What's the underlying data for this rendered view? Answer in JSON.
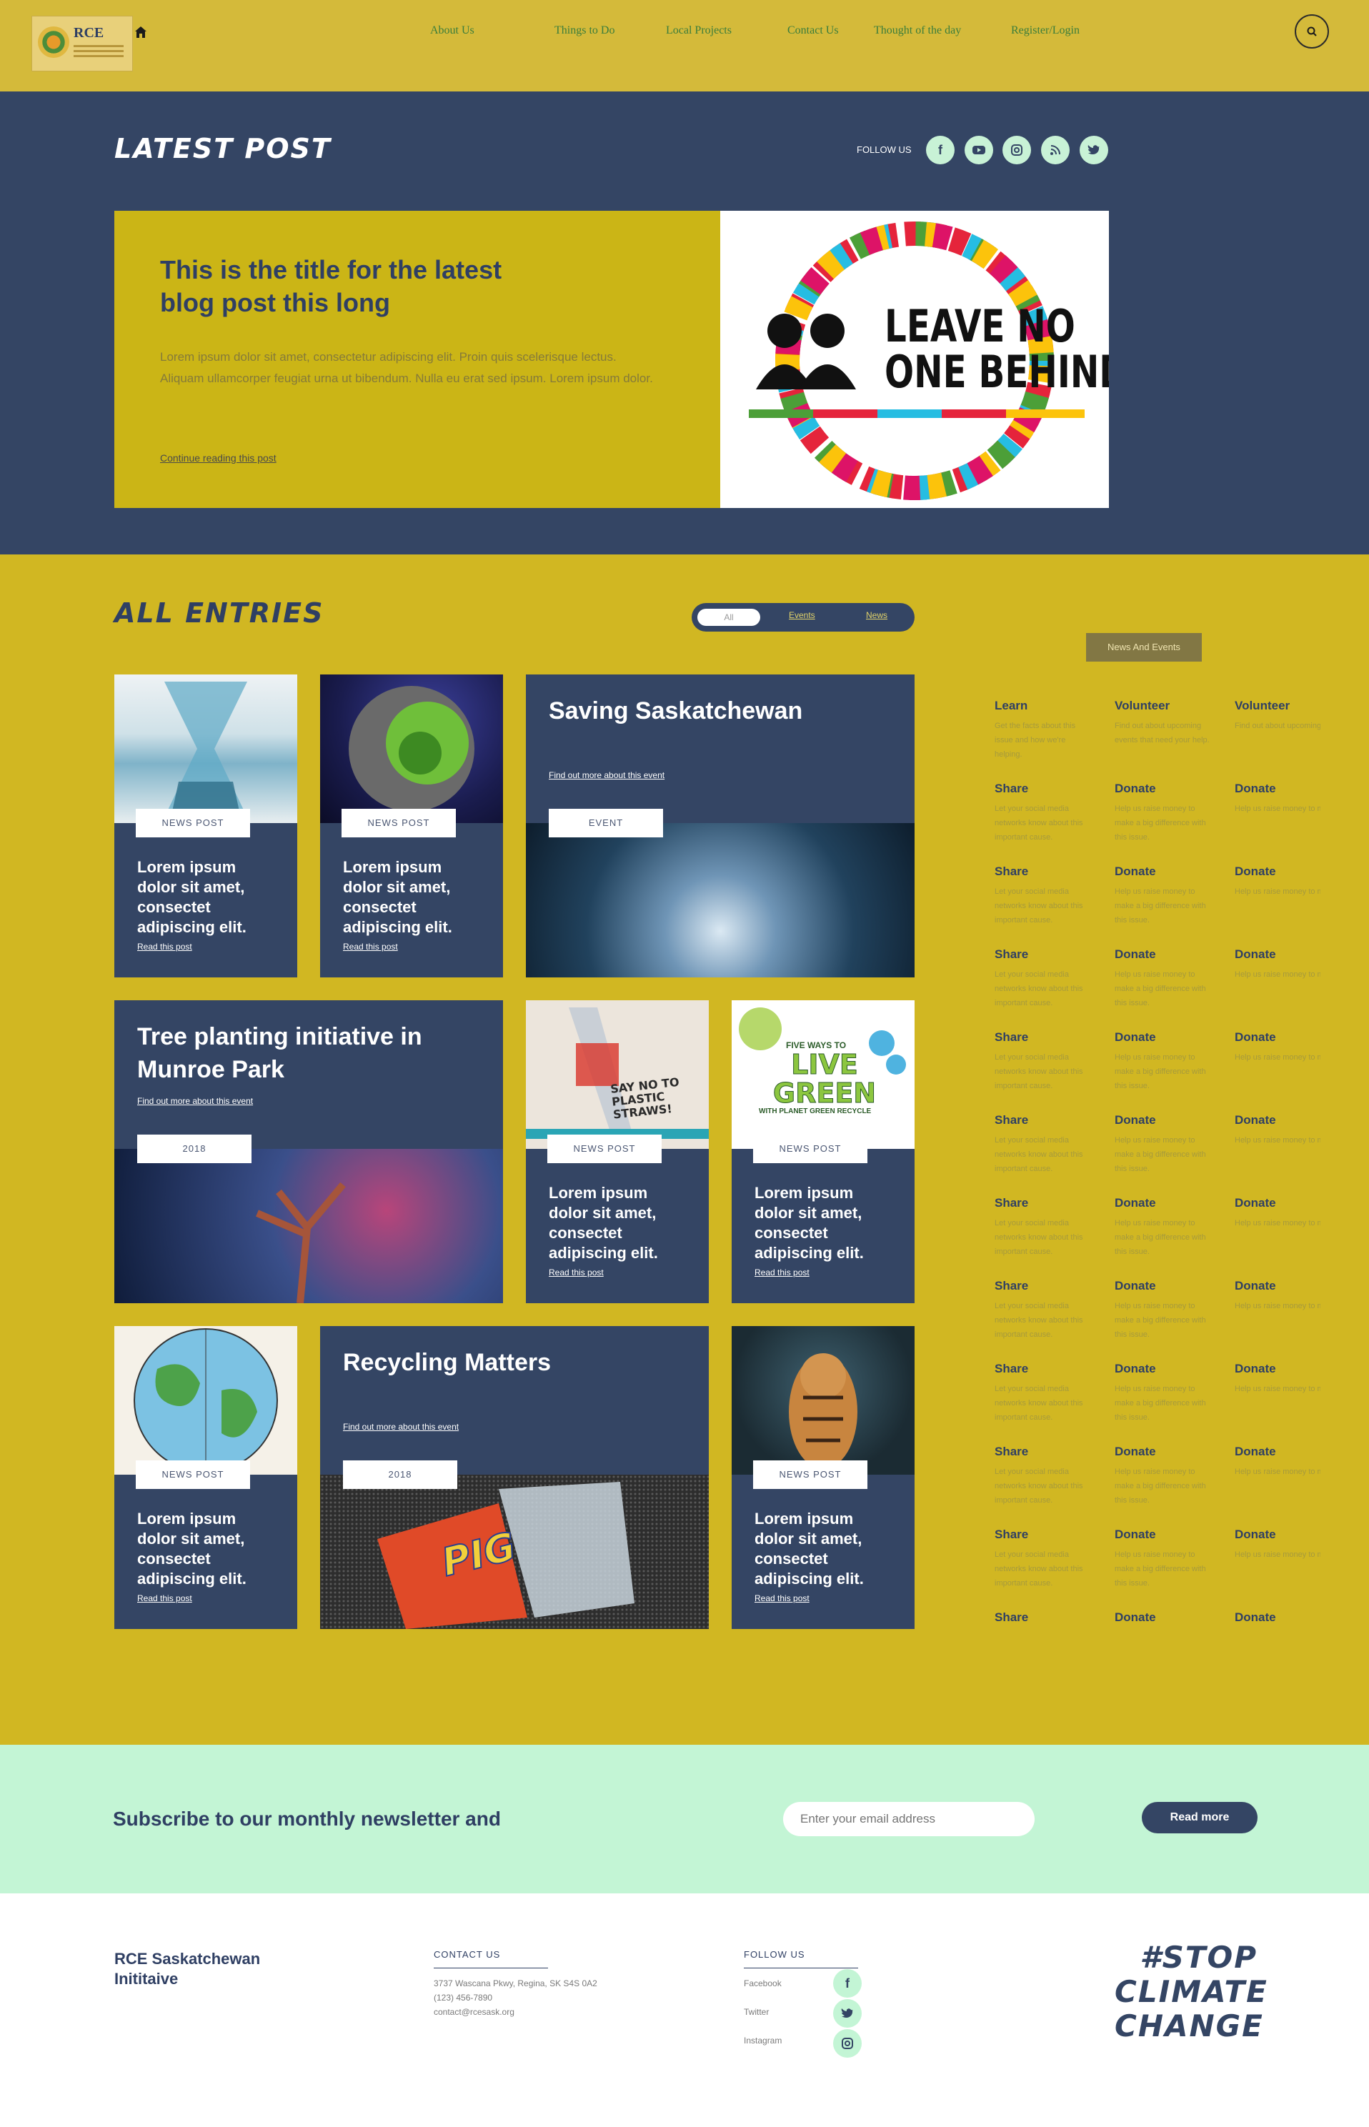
{
  "header": {
    "logo_text": "RCE",
    "nav": [
      "About Us",
      "Things to Do",
      "Local Projects",
      "Contact Us",
      "Thought of the day",
      "Register/Login"
    ]
  },
  "latest": {
    "section_title": "LATEST POST",
    "follow_label": "FOLLOW US",
    "social_icons": [
      "facebook-icon",
      "youtube-icon",
      "instagram-icon",
      "rss-icon",
      "twitter-icon"
    ],
    "post_title": "This is the title for the latest blog post this long",
    "post_text": "Lorem ipsum dolor sit amet, consectetur adipiscing elit. Proin quis scelerisque lectus. Aliquam ullamcorper feugiat urna ut bibendum. Nulla eu erat sed ipsum. Lorem ipsum dolor.",
    "continue_link": "Continue reading this post",
    "image_text_line1": "LEAVE NO",
    "image_text_line2": "ONE BEHIND"
  },
  "entries": {
    "section_title": "ALL ENTRIES",
    "filters": [
      "All",
      "Events",
      "News"
    ],
    "news_post_tag": "NEWS POST",
    "card_title": "Lorem ipsum dolor sit amet, consectet adipiscing elit.",
    "card_link": "Read this post",
    "featured": [
      {
        "title": "Saving Saskatchewan",
        "link": "Find out more about this event",
        "tag": "EVENT"
      },
      {
        "title": "Tree planting initiative in Munroe Park",
        "link": "Find out more about this event",
        "tag": "2018"
      },
      {
        "title": "Recycling Matters",
        "link": "Find out more about this event",
        "tag": "2018"
      }
    ],
    "image_captions": {
      "straws": "SAY NO TO PLASTIC STRAWS!",
      "green_top": "FIVE WAYS TO",
      "green_big": "LIVE GREEN",
      "green_sub": "WITH PLANET GREEN RECYCLE",
      "chips": "PIG"
    }
  },
  "sidebar": {
    "button": "News And Events",
    "top_row": [
      {
        "h": "Learn",
        "t": "Get the facts about this issue and how we're helping."
      },
      {
        "h": "Volunteer",
        "t": "Find out about upcoming events that need your help."
      },
      {
        "h": "Volunteer",
        "t": "Find out about upcoming events that need your help."
      }
    ],
    "share": {
      "h": "Share",
      "t": "Let your social media networks know about this important cause."
    },
    "donate": {
      "h": "Donate",
      "t": "Help us raise money to make a big difference with this issue."
    }
  },
  "newsletter": {
    "title": "Subscribe to our monthly newsletter and",
    "placeholder": "Enter your email address",
    "button": "Read more"
  },
  "footer": {
    "org_line1": "RCE Saskatchewan",
    "org_line2": "Inititaive",
    "contact_head": "CONTACT US",
    "address": "3737 Wascana Pkwy, Regina, SK S4S 0A2",
    "phone": "(123) 456-7890",
    "email": "contact@rcesask.org",
    "follow_head": "FOLLOW US",
    "follow_items": [
      "Facebook",
      "Twitter",
      "Instagram"
    ],
    "stop1": "#STOP",
    "stop2": "CLIMATE",
    "stop3": "CHANGE"
  },
  "colors": {
    "navy": "#344564",
    "mustard": "#d1b722",
    "mint": "#c3f5d5",
    "nav_green": "#3b7d3b"
  }
}
